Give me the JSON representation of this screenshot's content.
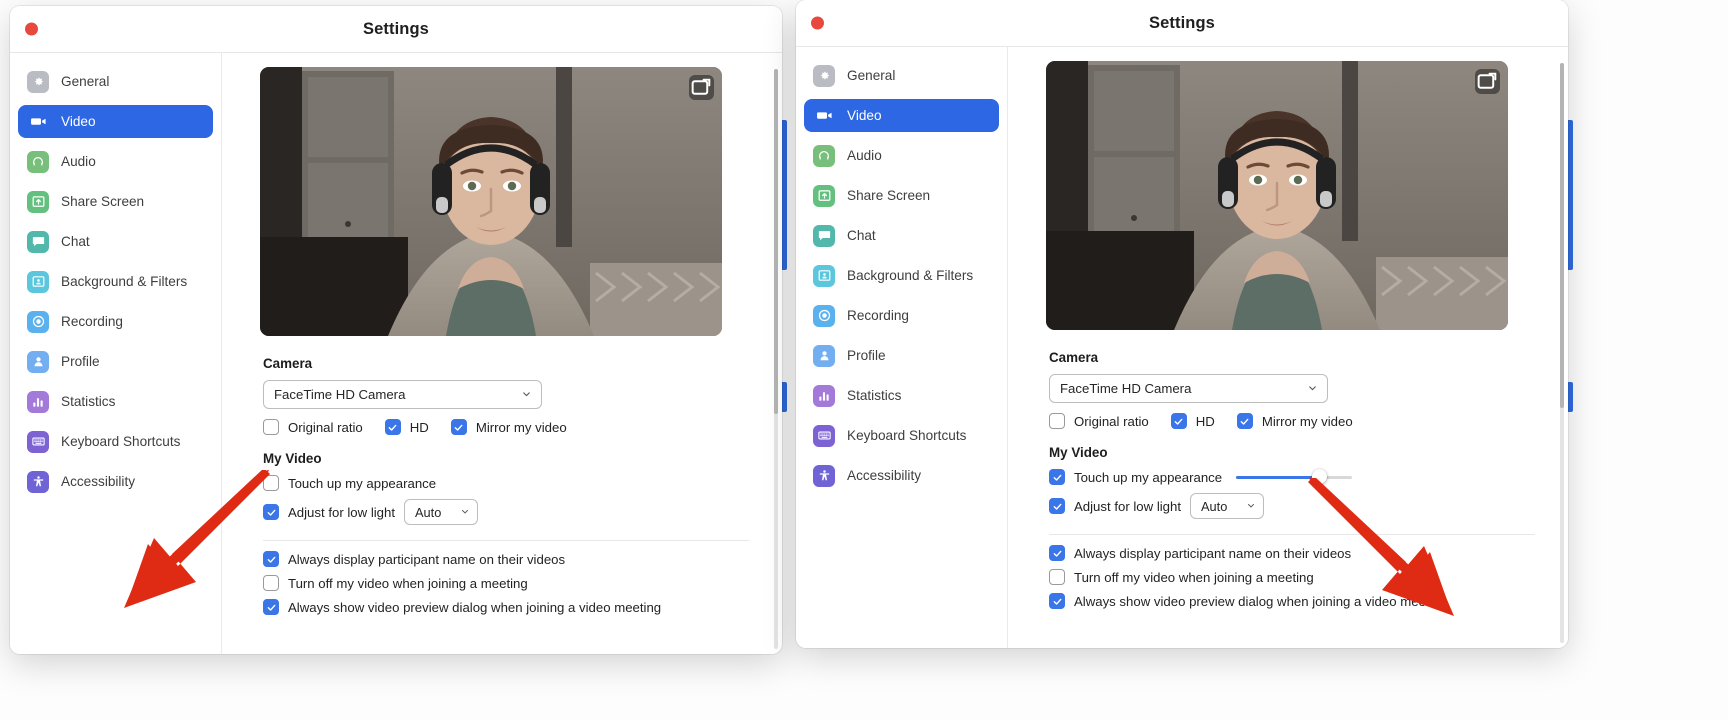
{
  "app": {
    "window_title": "Settings",
    "accent_color": "#2d67e3",
    "checkbox_color": "#3b76e8",
    "close_dot_color": "#e8493f",
    "annotation_arrow_color": "#e02b14"
  },
  "sidebar": {
    "items": [
      {
        "label": "General",
        "icon": "gear-icon",
        "color": "#b9bcc2",
        "active": false
      },
      {
        "label": "Video",
        "icon": "video-camera-icon",
        "color": "#2d67e3",
        "active": true
      },
      {
        "label": "Audio",
        "icon": "headphones-icon",
        "color": "#77bf7b",
        "active": false
      },
      {
        "label": "Share Screen",
        "icon": "share-screen-icon",
        "color": "#63c07f",
        "active": false
      },
      {
        "label": "Chat",
        "icon": "chat-bubble-icon",
        "color": "#52b8ac",
        "active": false
      },
      {
        "label": "Background & Filters",
        "icon": "person-frame-icon",
        "color": "#5cc6dd",
        "active": false
      },
      {
        "label": "Recording",
        "icon": "record-circle-icon",
        "color": "#59b2ee",
        "active": false
      },
      {
        "label": "Profile",
        "icon": "person-icon",
        "color": "#73aef0",
        "active": false
      },
      {
        "label": "Statistics",
        "icon": "bar-chart-icon",
        "color": "#a379da",
        "active": false
      },
      {
        "label": "Keyboard Shortcuts",
        "icon": "keyboard-icon",
        "color": "#7d62d4",
        "active": false
      },
      {
        "label": "Accessibility",
        "icon": "accessibility-icon",
        "color": "#6f63d6",
        "active": false
      }
    ]
  },
  "video_preview": {
    "pip_button": "picture-in-picture-icon"
  },
  "camera": {
    "heading": "Camera",
    "device_value": "FaceTime HD Camera",
    "options": [
      {
        "label": "Original ratio",
        "checked": false
      },
      {
        "label": "HD",
        "checked": true
      },
      {
        "label": "Mirror my video",
        "checked": true
      }
    ]
  },
  "my_video": {
    "heading": "My Video",
    "touch_up": {
      "label": "Touch up my appearance",
      "checked_left": false,
      "checked_right": true,
      "slider_percent": 72
    },
    "low_light": {
      "label": "Adjust for low light",
      "checked": true,
      "mode_value": "Auto"
    }
  },
  "meeting_options": [
    {
      "label": "Always display participant name on their videos",
      "checked": true
    },
    {
      "label": "Turn off my video when joining a meeting",
      "checked": false
    },
    {
      "label": "Always show video preview dialog when joining a video meeting",
      "checked": true
    }
  ]
}
